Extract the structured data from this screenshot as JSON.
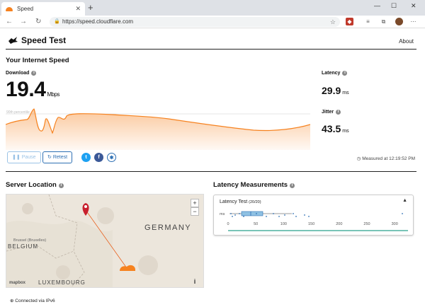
{
  "browser": {
    "tab_title": "Speed",
    "tab_close": "✕",
    "new_tab": "+",
    "win_min": "—",
    "win_max": "☐",
    "win_close": "✕",
    "url": "https://speed.cloudflare.com"
  },
  "header": {
    "title": "Speed Test",
    "about": "About"
  },
  "speed": {
    "section_title": "Your Internet Speed",
    "download_label": "Download",
    "download_value": "19.4",
    "download_unit": "Mbps",
    "latency_label": "Latency",
    "latency_value": "29.9",
    "latency_unit": "ms",
    "jitter_label": "Jitter",
    "jitter_value": "43.5",
    "jitter_unit": "ms",
    "percentile_label": "90th percentile",
    "accent_color": "#f6821f"
  },
  "controls": {
    "pause_label": "Pause",
    "retest_label": "Retest",
    "twitter": "t",
    "facebook": "f",
    "linkedin": "✱",
    "measured_at": "Measured at 12:19:52 PM"
  },
  "server": {
    "section_title": "Server Location",
    "map_labels": {
      "germany": "GERMANY",
      "belgium": "BELGIUM",
      "luxembourg": "LUXEMBOURG",
      "brussels": "Brussel (Bruxelles)"
    },
    "zoom_in": "+",
    "zoom_out": "−",
    "mapbox": "mapbox",
    "map_info": "i",
    "connection": "Connected via IPv6"
  },
  "latency_measurements": {
    "section_title": "Latency Measurements",
    "test_title": "Latency Test",
    "test_count": "(20/20)",
    "axis_unit": "ms",
    "axis_ticks": [
      "0",
      "50",
      "100",
      "150",
      "200",
      "250",
      "300"
    ]
  }
}
